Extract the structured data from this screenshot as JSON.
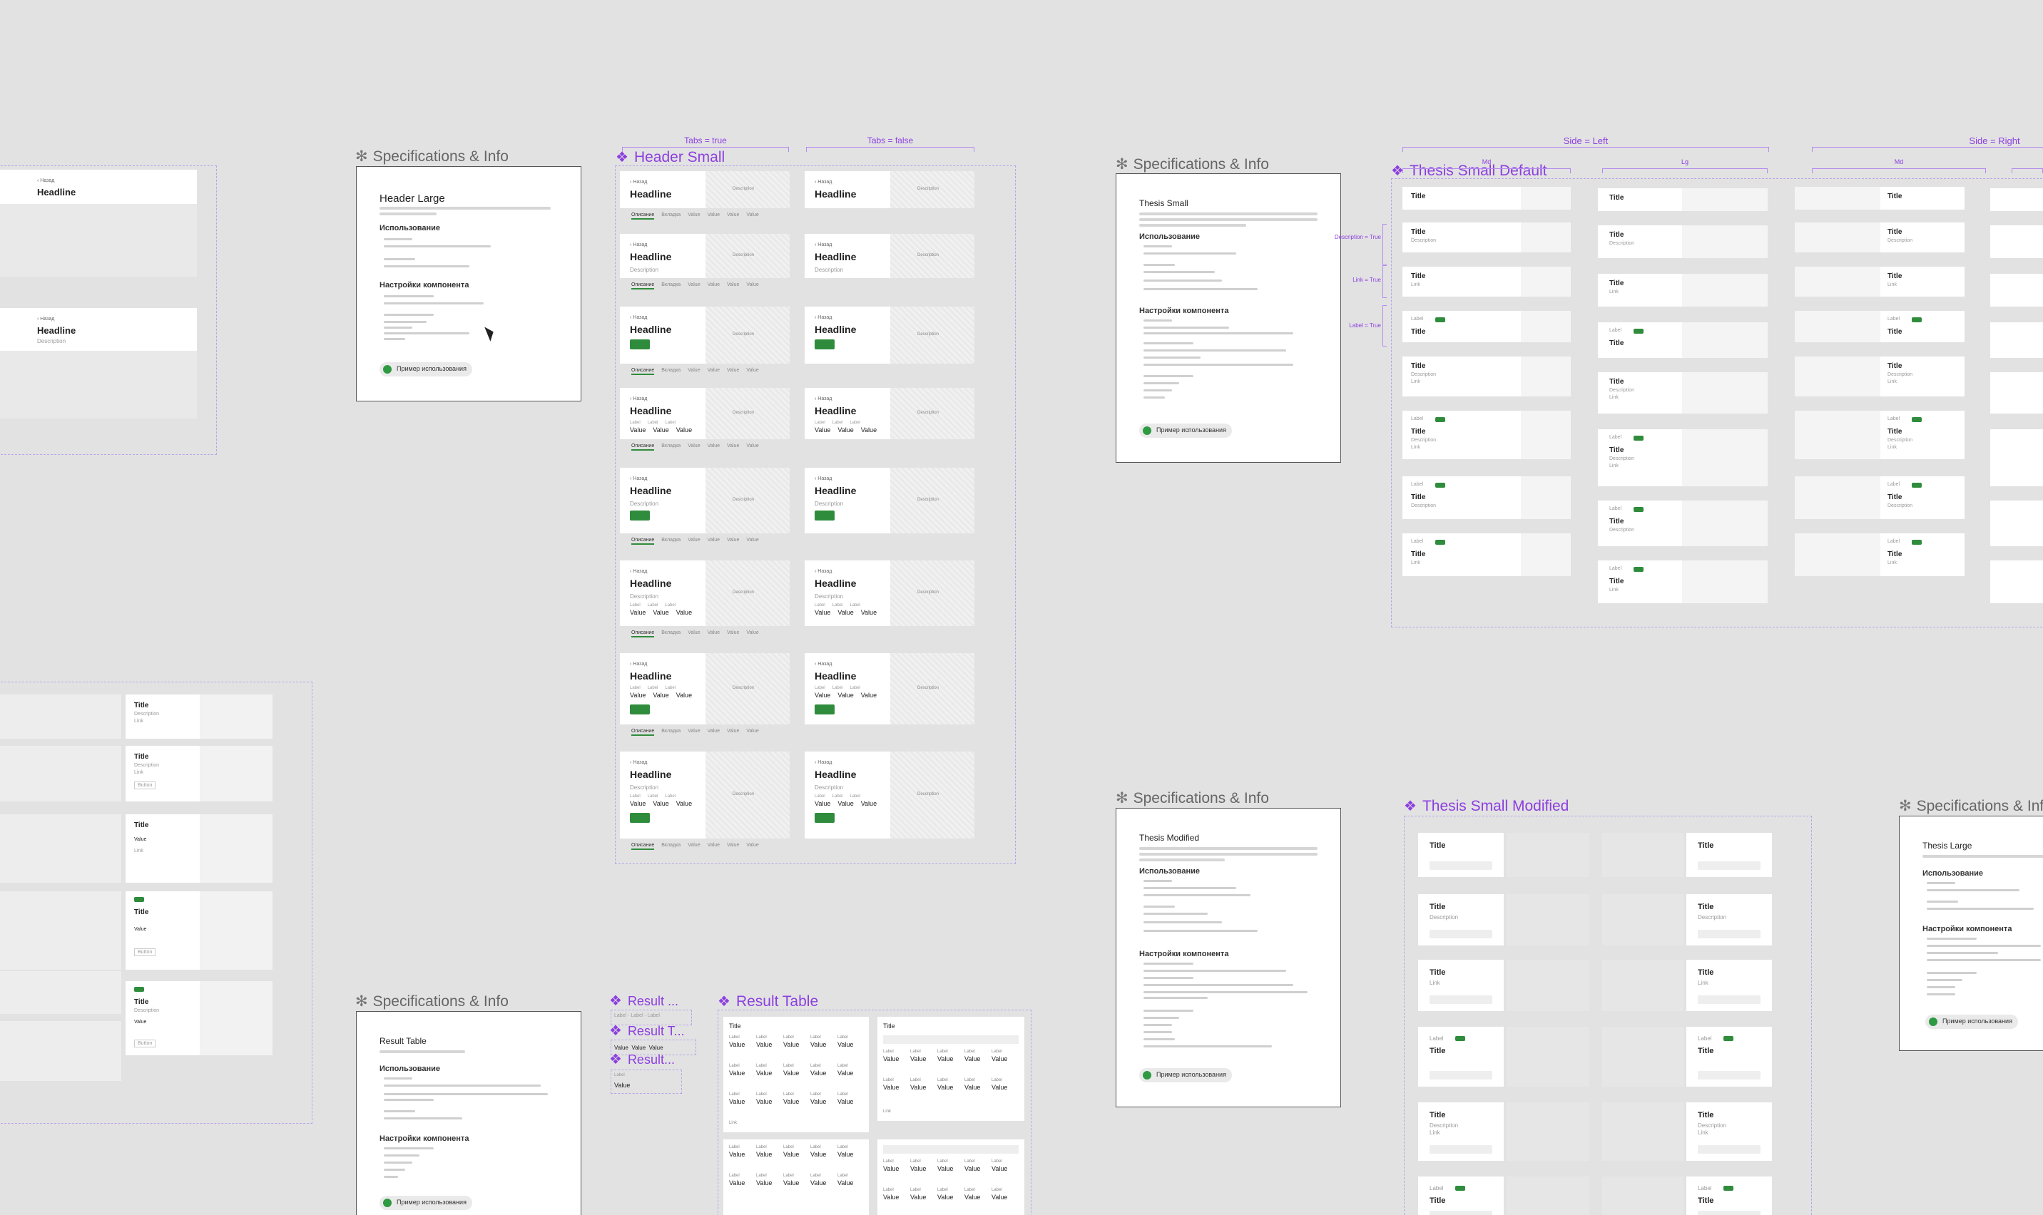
{
  "labels": {
    "spec": "Specifications & Info",
    "header_small": "Header Small",
    "thesis_small_default": "Thesis Small Default",
    "thesis_small_modified": "Thesis Small Modified",
    "result_table": "Result Table",
    "result_1": "Result ...",
    "result_2": "Result T...",
    "result_3": "Result...",
    "tabs_true": "Tabs = true",
    "tabs_false": "Tabs = false",
    "side_left": "Side = Left",
    "side_right": "Side = Right",
    "sz_md": "Md",
    "sz_lg": "Lg",
    "sz_md2": "Md",
    "prop_desc": "Description = True",
    "prop_link": "Link = True",
    "prop_label": "Label = True"
  },
  "card_text": {
    "back": "‹ Назад",
    "headline": "Headline",
    "description": "Description",
    "desc_right": "Description",
    "title": "Title",
    "label": "Label",
    "value": "Value",
    "link": "Link",
    "button": "Button",
    "tabs": [
      "Описание",
      "Вкладка",
      "Value",
      "Value",
      "Value",
      "Value"
    ]
  },
  "frames": {
    "header_large": {
      "title": "Header Large",
      "use": "Использование",
      "settings": "Настройки компонента",
      "example": "Пример использования"
    },
    "thesis_small": {
      "title": "Thesis Small",
      "use": "Использование",
      "settings": "Настройки компонента",
      "example": "Пример использования"
    },
    "thesis_modified": {
      "title": "Thesis Modified",
      "use": "Использование",
      "settings": "Настройки компонента",
      "example": "Пример использования"
    },
    "result_table": {
      "title": "Result Table",
      "use": "Использование",
      "settings": "Настройки компонента",
      "example": "Пример использования"
    },
    "thesis_large": {
      "title": "Thesis Large",
      "use": "Использование",
      "settings": "Настройки компонента",
      "example": "Пример использования"
    }
  },
  "colors": {
    "accent_purple": "#8c3fe0",
    "green": "#2f8c3c",
    "canvas": "#e2e2e2"
  }
}
